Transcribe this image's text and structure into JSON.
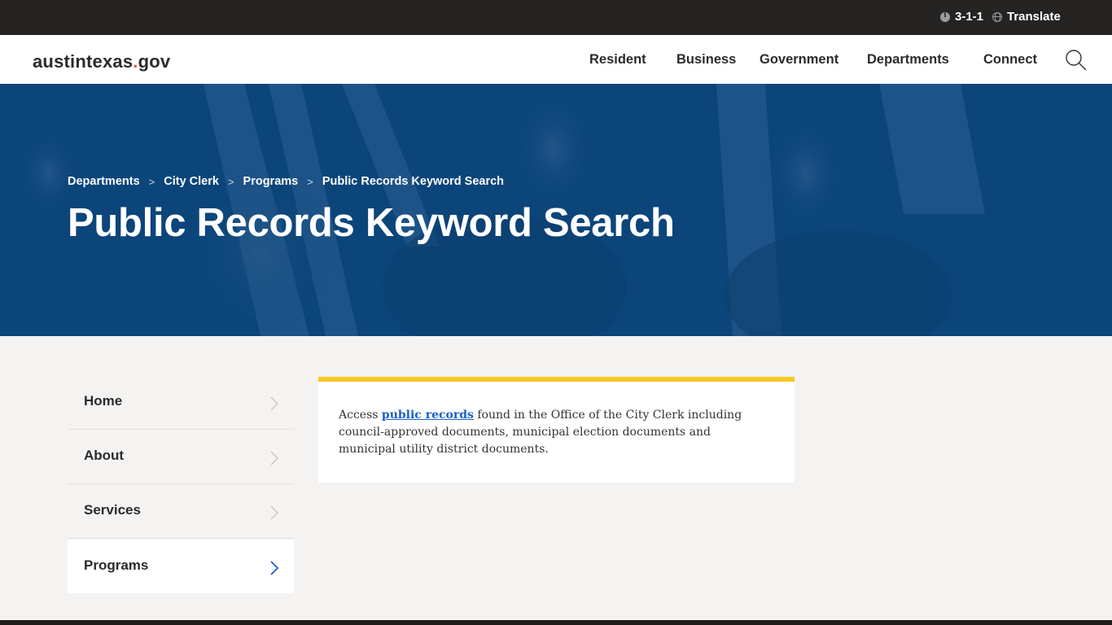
{
  "utility_bar": {
    "phone_311": "3-1-1",
    "translate": "Translate"
  },
  "header": {
    "logo_main": "austintexas",
    "logo_dot": ".",
    "logo_tld": "gov",
    "nav": [
      {
        "label": "Resident"
      },
      {
        "label": "Business"
      },
      {
        "label": "Government"
      },
      {
        "label": "Departments"
      },
      {
        "label": "Connect"
      }
    ]
  },
  "hero": {
    "breadcrumb": [
      {
        "label": "Departments"
      },
      {
        "label": "City Clerk"
      },
      {
        "label": "Programs"
      }
    ],
    "breadcrumb_separator": ">",
    "breadcrumb_current": "Public Records Keyword Search",
    "title": "Public Records Keyword Search"
  },
  "sidenav": {
    "items": [
      {
        "label": "Home",
        "active": false
      },
      {
        "label": "About",
        "active": false
      },
      {
        "label": "Services",
        "active": false
      },
      {
        "label": "Programs",
        "active": true
      }
    ]
  },
  "content": {
    "intro_before": "Access ",
    "intro_link": "public records",
    "intro_after": " found in the Office of the City Clerk including council-approved documents, municipal election documents and municipal utility district documents."
  },
  "colors": {
    "utility_bar": "#252423",
    "hero_blue": "#0a4479",
    "accent_yellow": "#f8c824",
    "link_blue": "#1a5fc5",
    "logo_dot": "#e05b3c",
    "page_bg": "#f4f3f1"
  }
}
